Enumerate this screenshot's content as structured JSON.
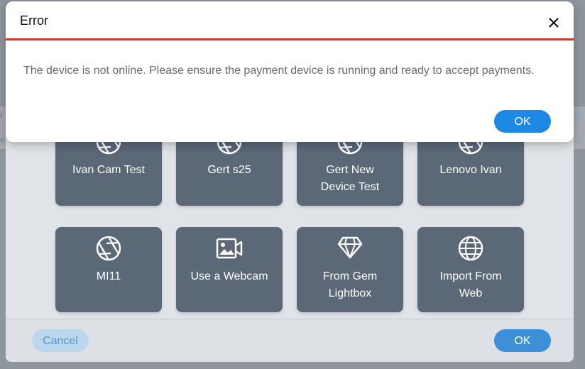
{
  "background": {
    "left_fragment": "r",
    "left_fragment2": "e",
    "right_fragment": "er"
  },
  "picker": {
    "tiles": [
      {
        "label": "Ivan Cam Test",
        "icon": "camera-aperture-icon"
      },
      {
        "label": "Gert s25",
        "icon": "camera-aperture-icon"
      },
      {
        "label": "Gert New\nDevice Test",
        "icon": "camera-aperture-icon"
      },
      {
        "label": "Lenovo Ivan",
        "icon": "camera-aperture-icon"
      },
      {
        "label": "MI11",
        "icon": "camera-aperture-icon"
      },
      {
        "label": "Use a Webcam",
        "icon": "webcam-icon"
      },
      {
        "label": "From Gem\nLightbox",
        "icon": "gem-icon"
      },
      {
        "label": "Import From\nWeb",
        "icon": "globe-icon"
      }
    ],
    "cancel_label": "Cancel",
    "ok_label": "OK"
  },
  "error": {
    "title": "Error",
    "message": "The device is not online. Please ensure the payment device is running and ready to accept payments.",
    "ok_label": "OK"
  },
  "colors": {
    "tile_bg": "#5b6878",
    "accent": "#1e88e5",
    "error_line": "#cc3a32"
  }
}
